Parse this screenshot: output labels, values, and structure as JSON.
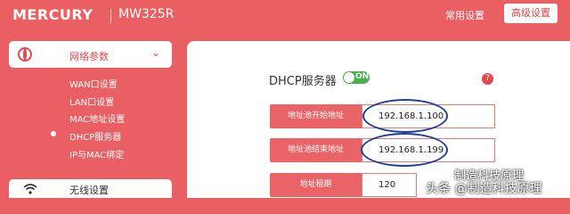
{
  "header": {
    "logo": "MERCURY",
    "model": "MW325R",
    "common_settings": "常用设置",
    "advanced_settings": "高级设置"
  },
  "sidebar": {
    "network_params": "网络参数",
    "items": [
      {
        "label": "WAN口设置"
      },
      {
        "label": "LAN口设置"
      },
      {
        "label": "MAC地址设置"
      },
      {
        "label": "DHCP服务器"
      },
      {
        "label": "IP与MAC绑定"
      }
    ],
    "wireless": "无线设置"
  },
  "main": {
    "dhcp_title": "DHCP服务器",
    "toggle_label": "ON",
    "fields": [
      {
        "label": "地址池开始地址",
        "value": "192.168.1.100"
      },
      {
        "label": "地址池结束地址",
        "value": "192.168.1.199"
      },
      {
        "label": "地址租期",
        "value": "120"
      }
    ]
  },
  "watermark": {
    "line1": "制造科技原理",
    "line2": "头条 @制造科技原理"
  },
  "colors": {
    "brand": "#ea5f62",
    "accent": "#e2474f",
    "toggle_on": "#48b04c",
    "annotation": "#1e3f9a"
  }
}
